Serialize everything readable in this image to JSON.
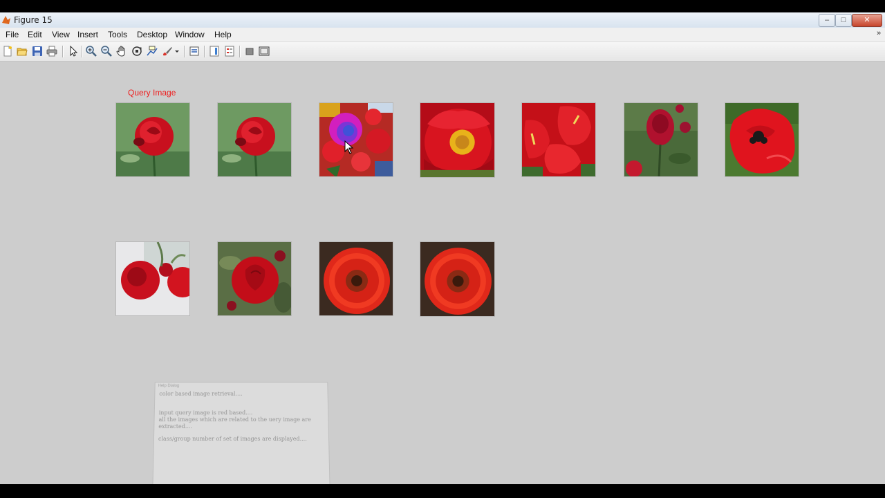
{
  "window": {
    "title": "Figure 15",
    "min_glyph": "–",
    "max_glyph": "□",
    "close_glyph": "✕"
  },
  "menu": [
    "File",
    "Edit",
    "View",
    "Insert",
    "Tools",
    "Desktop",
    "Window",
    "Help"
  ],
  "menu_overflow": "»",
  "toolbar": [
    "new-figure-icon",
    "open-file-icon",
    "save-icon",
    "print-icon",
    "edit-plot-arrow-icon",
    "zoom-in-icon",
    "zoom-out-icon",
    "pan-hand-icon",
    "rotate-3d-icon",
    "data-cursor-icon",
    "brush-icon",
    "brush-dropdown-icon",
    "link-plot-icon",
    "insert-colorbar-icon",
    "insert-legend-icon",
    "hide-plot-tools-icon",
    "show-plot-tools-icon"
  ],
  "figure": {
    "query_label": "Query Image",
    "images": [
      "red-rose-query",
      "red-rose-match",
      "red-flowers-selected",
      "red-peony",
      "red-anthurium",
      "red-roses-bush",
      "red-poppy",
      "red-roses-cluster",
      "single-red-rose",
      "red-gerbera",
      "red-gerbera-2"
    ]
  },
  "message_box": {
    "title": "Help Dialog",
    "lines": [
      "color based image retrieval....",
      "input query image is red based....",
      "all the images which are related to the uery image are",
      "extracted....",
      "class/group number of set of images are displayed...."
    ]
  },
  "colors": {
    "query_label": "#ee1c1c",
    "background": "#cdcdcd"
  }
}
